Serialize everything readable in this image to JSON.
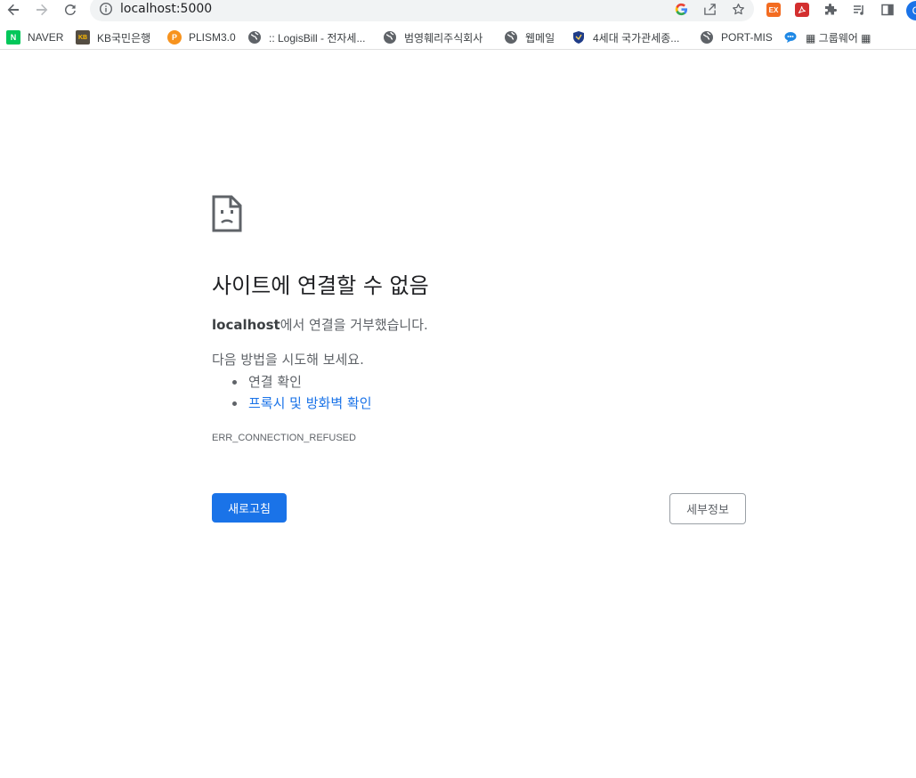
{
  "browser": {
    "url": "localhost:5000",
    "profile_initial": "C",
    "extensions": [
      {
        "name": "ex-extension",
        "label": "EX",
        "color": "#f36c21"
      },
      {
        "name": "acrobat-extension",
        "label": "",
        "color": "#d32f2f"
      }
    ]
  },
  "bookmarks": [
    {
      "label": "NAVER",
      "icon": "naver-icon",
      "icon_text": "N",
      "color": "#03c75a"
    },
    {
      "label": "KB국민은행",
      "icon": "kb-icon",
      "icon_text": "KB",
      "color": "#544d42"
    },
    {
      "label": "PLISM3.0",
      "icon": "plism-icon",
      "icon_text": "P",
      "color": "#f7931e"
    },
    {
      "label": ":: LogisBill - 전자세...",
      "icon": "globe-icon"
    },
    {
      "label": "범영훼리주식회사",
      "icon": "globe-icon"
    },
    {
      "label": "웹메일",
      "icon": "globe-icon"
    },
    {
      "label": "4세대 국가관세종...",
      "icon": "shield-icon"
    },
    {
      "label": "PORT-MIS",
      "icon": "globe-icon"
    },
    {
      "label": "▦ 그룹웨어 ▦",
      "icon": "chat-icon"
    }
  ],
  "error": {
    "title": "사이트에 연결할 수 없음",
    "host": "localhost",
    "summary_suffix": "에서 연결을 거부했습니다.",
    "suggestion_title": "다음 방법을 시도해 보세요.",
    "suggestions": [
      {
        "label": "연결 확인",
        "link": false
      },
      {
        "label": "프록시 및 방화벽 확인",
        "link": true
      }
    ],
    "code": "ERR_CONNECTION_REFUSED",
    "reload_label": "새로고침",
    "details_label": "세부정보"
  },
  "colors": {
    "primary": "#1a73e8",
    "text_secondary": "#5f6368"
  }
}
